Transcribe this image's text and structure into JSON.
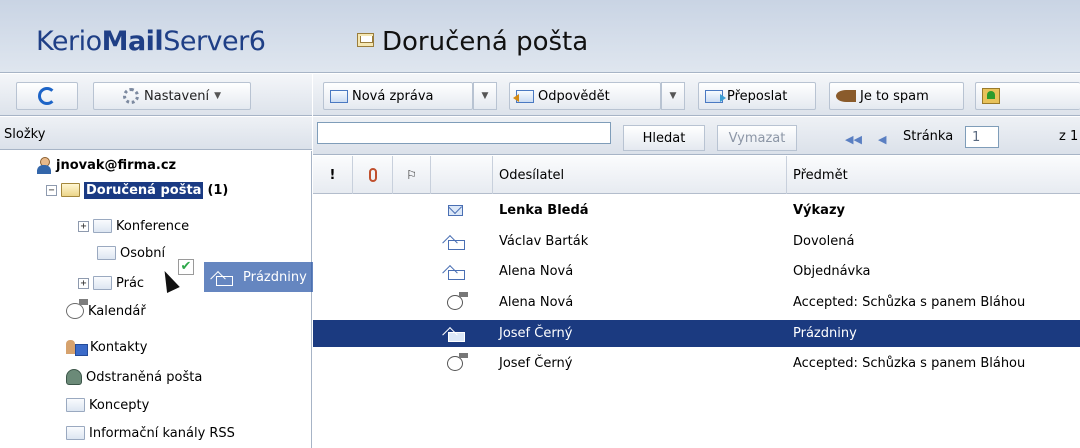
{
  "app": {
    "brand_prefix": "Kerio",
    "brand_mail": "Mail",
    "brand_server": "Server",
    "brand_version": "6",
    "page_title": "Doručená pošta"
  },
  "left_toolbar": {
    "refresh_icon": "refresh-icon",
    "settings_label": "Nastavení"
  },
  "folders": {
    "header": "Složky",
    "account": "jnovak@firma.cz",
    "inbox_label": "Doručená pošta",
    "inbox_count": "(1)",
    "items": [
      {
        "label": "Konference",
        "icon": "folder-icon"
      },
      {
        "label": "Osobní",
        "icon": "folder-icon"
      },
      {
        "label": "Práce",
        "icon": "folder-icon"
      },
      {
        "label": "Kalendář",
        "icon": "calendar-icon"
      },
      {
        "label": "Kontakty",
        "icon": "contacts-icon"
      },
      {
        "label": "Odstraněná pošta",
        "icon": "trash-icon"
      },
      {
        "label": "Koncepty",
        "icon": "folder-icon"
      },
      {
        "label": "Informační kanály RSS",
        "icon": "folder-icon"
      }
    ],
    "osobni_visible": "Osobní",
    "prace_visible": "Prác"
  },
  "drag": {
    "ghost_label": "Prázdniny",
    "check": "✔"
  },
  "toolbar": {
    "new_message": "Nová zpráva",
    "reply": "Odpovědět",
    "forward": "Přeposlat",
    "spam": "Je to spam"
  },
  "searchbar": {
    "search_value": "",
    "search_button": "Hledat",
    "clear_button": "Vymazat",
    "page_label": "Stránka",
    "page_value": "1",
    "page_of": "z 1"
  },
  "grid": {
    "columns": {
      "priority": "!",
      "sender": "Odesílatel",
      "subject": "Předmět"
    },
    "rows": [
      {
        "sender": "Lenka Bledá",
        "subject": "Výkazy",
        "icon": "unread-envelope-icon",
        "unread": true,
        "selected": false
      },
      {
        "sender": "Václav Barták",
        "subject": "Dovolená",
        "icon": "read-envelope-icon",
        "unread": false,
        "selected": false
      },
      {
        "sender": "Alena Nová",
        "subject": "Objednávka",
        "icon": "read-envelope-icon",
        "unread": false,
        "selected": false
      },
      {
        "sender": "Alena Nová",
        "subject": "Accepted: Schůzka s panem Bláhou",
        "icon": "meeting-response-icon",
        "unread": false,
        "selected": false
      },
      {
        "sender": "Josef Černý",
        "subject": "Prázdniny",
        "icon": "read-envelope-icon",
        "unread": false,
        "selected": true
      },
      {
        "sender": "Josef Černý",
        "subject": "Accepted: Schůzka s panem Bláhou",
        "icon": "meeting-response-icon",
        "unread": false,
        "selected": false
      }
    ]
  },
  "colors": {
    "selection": "#1b3a80",
    "brand": "#1f3f86",
    "header_bg": "#cfd8e6"
  }
}
